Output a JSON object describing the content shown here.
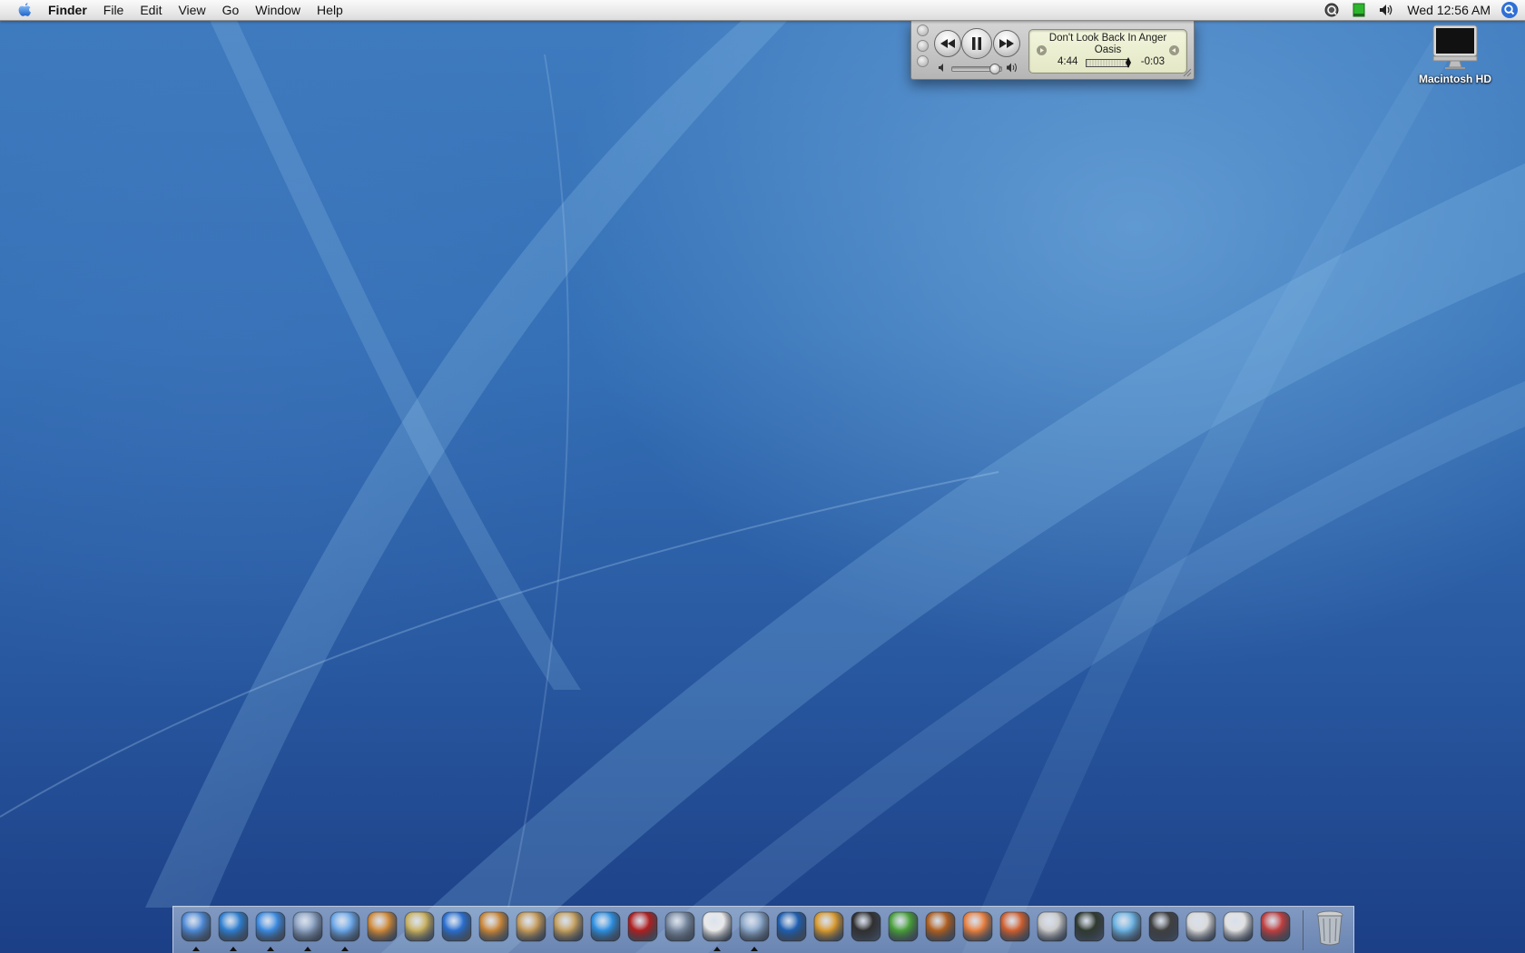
{
  "menubar": {
    "app_name": "Finder",
    "items": [
      "File",
      "Edit",
      "View",
      "Go",
      "Window",
      "Help"
    ],
    "clock": "Wed 12:56 AM",
    "status_icons": [
      "quicksilver-icon",
      "battery-icon",
      "volume-icon"
    ]
  },
  "desktop": {
    "hd_label": "Macintosh HD"
  },
  "mini_player": {
    "track": "Don't Look Back In Anger",
    "artist": "Oasis",
    "elapsed": "4:44",
    "remaining": "-0:03",
    "progress": 0.99,
    "volume": 0.85
  },
  "dock": {
    "apps": [
      {
        "name": "finder",
        "color": "#4f8ad6",
        "running": true
      },
      {
        "name": "safari",
        "color": "#2f7fd0",
        "running": true
      },
      {
        "name": "ichat",
        "color": "#3d8ae0",
        "running": true
      },
      {
        "name": "mail",
        "color": "#8aa0c0",
        "running": true
      },
      {
        "name": "itunes",
        "color": "#6aa6e8",
        "running": true
      },
      {
        "name": "iphoto",
        "color": "#d08a3a",
        "running": false
      },
      {
        "name": "imovie",
        "color": "#c8b060",
        "running": false
      },
      {
        "name": "idvd",
        "color": "#2a6fcf",
        "running": false
      },
      {
        "name": "garageband",
        "color": "#c9873a",
        "running": false
      },
      {
        "name": "iweb",
        "color": "#c49a5a",
        "running": false
      },
      {
        "name": "address-book",
        "color": "#c4a060",
        "running": false
      },
      {
        "name": "quicktime",
        "color": "#2e8fe0",
        "running": false
      },
      {
        "name": "photo-booth",
        "color": "#b02020",
        "running": false
      },
      {
        "name": "automator",
        "color": "#7a8aa0",
        "running": false
      },
      {
        "name": "textedit",
        "color": "#e8e8e8",
        "running": true
      },
      {
        "name": "preview",
        "color": "#8aa6c8",
        "running": true
      },
      {
        "name": "google-earth",
        "color": "#1f5fb0",
        "running": false
      },
      {
        "name": "pencil-app",
        "color": "#d89a30",
        "running": false
      },
      {
        "name": "video-app",
        "color": "#303030",
        "running": false
      },
      {
        "name": "hairdryer-app",
        "color": "#4aa03a",
        "running": false
      },
      {
        "name": "cog-player",
        "color": "#b06020",
        "running": false
      },
      {
        "name": "piggy-bank",
        "color": "#e88040",
        "running": false
      },
      {
        "name": "umbrella-app",
        "color": "#d06030",
        "running": false
      },
      {
        "name": "classic-mac",
        "color": "#c8c8c8",
        "running": false
      },
      {
        "name": "activity-monitor",
        "color": "#303a30",
        "running": false
      },
      {
        "name": "fish-app",
        "color": "#6ab0e0",
        "running": false
      },
      {
        "name": "burn-app",
        "color": "#404040",
        "running": false
      },
      {
        "name": "printer-app",
        "color": "#d8d8d8",
        "running": false
      },
      {
        "name": "apple-app",
        "color": "#e0e0e0",
        "running": false
      },
      {
        "name": "utility-app",
        "color": "#c04040",
        "running": false
      }
    ],
    "trash": {
      "name": "trash"
    }
  }
}
